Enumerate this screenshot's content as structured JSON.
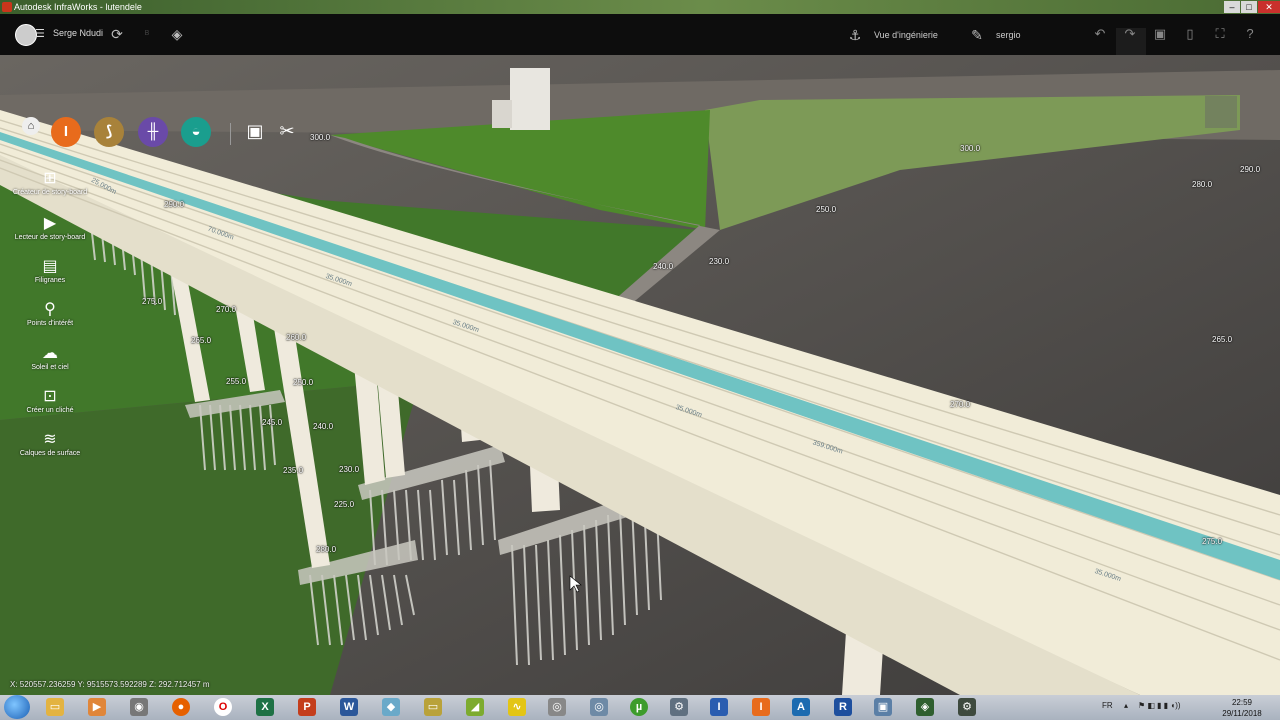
{
  "window": {
    "title": "Autodesk InfraWorks - lutendele"
  },
  "header": {
    "user": "Serge Ndudi",
    "view_label": "Vue d'ingénierie",
    "account": "sergio"
  },
  "toolbar": {
    "scale_value": "300.0"
  },
  "side_panel": {
    "items": [
      {
        "label": "Créateur de story-board",
        "icon": "storyboard-creator-icon"
      },
      {
        "label": "Lecteur de story-board",
        "icon": "storyboard-player-icon"
      },
      {
        "label": "Filigranes",
        "icon": "watermark-icon"
      },
      {
        "label": "Points d'intérêt",
        "icon": "points-of-interest-icon"
      },
      {
        "label": "Soleil et ciel",
        "icon": "sun-sky-icon"
      },
      {
        "label": "Créer un cliché",
        "icon": "camera-icon"
      },
      {
        "label": "Calques de surface",
        "icon": "surface-layers-icon"
      }
    ]
  },
  "contours": [
    "300.0",
    "300.0",
    "290.0",
    "290.0",
    "280.0",
    "250.0",
    "240.0",
    "230.0",
    "265.0",
    "270.0",
    "275.0",
    "275.0",
    "270.0",
    "265.0",
    "260.0",
    "255.0",
    "250.0",
    "245.0",
    "240.0",
    "235.0",
    "230.0",
    "225.0",
    "280.0"
  ],
  "dimensions": [
    "25.000m",
    "70.000m",
    "35.000m",
    "35.000m",
    "35.000m",
    "359.000m",
    "35.000m"
  ],
  "status": {
    "coordinates": "X: 520557.236259 Y: 9515573.592289 Z: 292.712457 m"
  },
  "taskbar": {
    "language": "FR",
    "time": "22:59",
    "date": "29/11/2018"
  },
  "colors": {
    "bridge_deck": "#f1ecd8",
    "median": "#6fc3c3",
    "grass": "#4f8a2a",
    "terrain": "#5a5654"
  }
}
